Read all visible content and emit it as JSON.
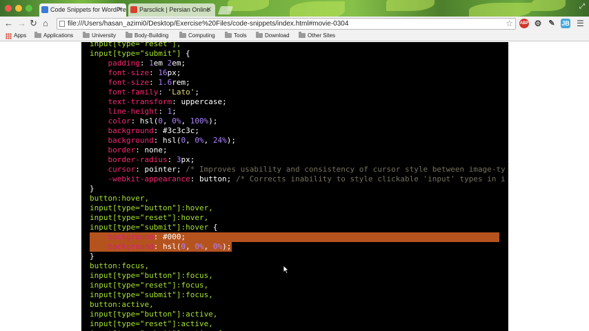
{
  "browser": {
    "tabs": [
      {
        "title": "Code Snippets for WordPress",
        "active": true
      },
      {
        "title": "Parsclick | Persian Online",
        "active": false
      }
    ],
    "address": "file:///Users/hasan_azimi0/Desktop/Exercise%20Files/code-snippets/index.html#movie-0304",
    "extensions": [
      "ABP",
      "gear",
      "pen",
      "JB"
    ],
    "bookmarks": [
      {
        "label": "Apps",
        "type": "apps"
      },
      {
        "label": "Applications",
        "type": "folder"
      },
      {
        "label": "University",
        "type": "folder"
      },
      {
        "label": "Body-Building",
        "type": "folder"
      },
      {
        "label": "Computing",
        "type": "folder"
      },
      {
        "label": "Tools",
        "type": "folder"
      },
      {
        "label": "Download",
        "type": "folder"
      },
      {
        "label": "Other Sites",
        "type": "folder"
      }
    ]
  },
  "code": {
    "lines": [
      [
        {
          "t": "input[type=\"reset\"],",
          "c": "sel"
        }
      ],
      [
        {
          "t": "input[type=\"submit\"] ",
          "c": "sel"
        },
        {
          "t": "{",
          "c": "txt"
        }
      ],
      [
        {
          "t": "    padding",
          "c": "prop"
        },
        {
          "t": ": ",
          "c": "txt"
        },
        {
          "t": "1",
          "c": "num"
        },
        {
          "t": "em ",
          "c": "txt"
        },
        {
          "t": "2",
          "c": "num"
        },
        {
          "t": "em;",
          "c": "txt"
        }
      ],
      [
        {
          "t": "    font-size",
          "c": "prop"
        },
        {
          "t": ": ",
          "c": "txt"
        },
        {
          "t": "16",
          "c": "num"
        },
        {
          "t": "px;",
          "c": "txt"
        }
      ],
      [
        {
          "t": "    font-size",
          "c": "prop"
        },
        {
          "t": ": ",
          "c": "txt"
        },
        {
          "t": "1.6",
          "c": "num"
        },
        {
          "t": "rem;",
          "c": "txt"
        }
      ],
      [
        {
          "t": "    font-family",
          "c": "prop"
        },
        {
          "t": ": ",
          "c": "txt"
        },
        {
          "t": "'Lato'",
          "c": "str"
        },
        {
          "t": ";",
          "c": "txt"
        }
      ],
      [
        {
          "t": "    text-transform",
          "c": "prop"
        },
        {
          "t": ": uppercase;",
          "c": "txt"
        }
      ],
      [
        {
          "t": "    line-height",
          "c": "prop"
        },
        {
          "t": ": ",
          "c": "txt"
        },
        {
          "t": "1",
          "c": "num"
        },
        {
          "t": ";",
          "c": "txt"
        }
      ],
      [
        {
          "t": "    color",
          "c": "prop"
        },
        {
          "t": ": hsl(",
          "c": "txt"
        },
        {
          "t": "0",
          "c": "num"
        },
        {
          "t": ", ",
          "c": "txt"
        },
        {
          "t": "0%",
          "c": "num"
        },
        {
          "t": ", ",
          "c": "txt"
        },
        {
          "t": "100%",
          "c": "num"
        },
        {
          "t": ");",
          "c": "txt"
        }
      ],
      [
        {
          "t": "    background",
          "c": "prop"
        },
        {
          "t": ": #3c3c3c;",
          "c": "txt"
        }
      ],
      [
        {
          "t": "    background",
          "c": "prop"
        },
        {
          "t": ": hsl(",
          "c": "txt"
        },
        {
          "t": "0",
          "c": "num"
        },
        {
          "t": ", ",
          "c": "txt"
        },
        {
          "t": "0%",
          "c": "num"
        },
        {
          "t": ", ",
          "c": "txt"
        },
        {
          "t": "24%",
          "c": "num"
        },
        {
          "t": ");",
          "c": "txt"
        }
      ],
      [
        {
          "t": "    border",
          "c": "prop"
        },
        {
          "t": ": none;",
          "c": "txt"
        }
      ],
      [
        {
          "t": "    border-radius",
          "c": "prop"
        },
        {
          "t": ": ",
          "c": "txt"
        },
        {
          "t": "3",
          "c": "num"
        },
        {
          "t": "px;",
          "c": "txt"
        }
      ],
      [
        {
          "t": "    cursor",
          "c": "prop"
        },
        {
          "t": ": pointer; ",
          "c": "txt"
        },
        {
          "t": "/* Improves usability and consistency of cursor style between image-ty",
          "c": "cm"
        }
      ],
      [
        {
          "t": "    -webkit-appearance",
          "c": "prop"
        },
        {
          "t": ": button; ",
          "c": "txt"
        },
        {
          "t": "/* Corrects inability to style clickable 'input' types in i",
          "c": "cm"
        }
      ],
      [
        {
          "t": "}",
          "c": "txt"
        }
      ],
      [
        {
          "t": "button:hover,",
          "c": "sel"
        }
      ],
      [
        {
          "t": "input[type=\"button\"]:hover,",
          "c": "sel"
        }
      ],
      [
        {
          "t": "input[type=\"reset\"]:hover,",
          "c": "sel"
        }
      ],
      [
        {
          "t": "input[type=\"submit\"]:hover ",
          "c": "sel"
        },
        {
          "t": "{",
          "c": "txt"
        }
      ],
      [
        {
          "t": "    background",
          "c": "prop"
        },
        {
          "t": ": #000;",
          "c": "txt"
        }
      ],
      [
        {
          "t": "    background",
          "c": "prop"
        },
        {
          "t": ": hsl(",
          "c": "txt"
        },
        {
          "t": "0",
          "c": "num"
        },
        {
          "t": ", ",
          "c": "txt"
        },
        {
          "t": "0%",
          "c": "num"
        },
        {
          "t": ", ",
          "c": "txt"
        },
        {
          "t": "0%",
          "c": "num"
        },
        {
          "t": ");",
          "c": "txt"
        }
      ],
      [
        {
          "t": "}",
          "c": "txt"
        }
      ],
      [
        {
          "t": "button:focus,",
          "c": "sel"
        }
      ],
      [
        {
          "t": "input[type=\"button\"]:focus,",
          "c": "sel"
        }
      ],
      [
        {
          "t": "input[type=\"reset\"]:focus,",
          "c": "sel"
        }
      ],
      [
        {
          "t": "input[type=\"submit\"]:focus,",
          "c": "sel"
        }
      ],
      [
        {
          "t": "button:active,",
          "c": "sel"
        }
      ],
      [
        {
          "t": "input[type=\"button\"]:active,",
          "c": "sel"
        }
      ],
      [
        {
          "t": "input[type=\"reset\"]:active,",
          "c": "sel"
        }
      ],
      [
        {
          "t": "input[type=\"submit\"]:active {",
          "c": "sel"
        }
      ]
    ],
    "highlighted_lines": [
      20,
      21
    ]
  },
  "colors": {
    "selector": "#a6e22e",
    "property": "#f92672",
    "number": "#ae81ff",
    "string": "#e6db74",
    "comment": "#75715e",
    "selection": "#b5531f"
  }
}
